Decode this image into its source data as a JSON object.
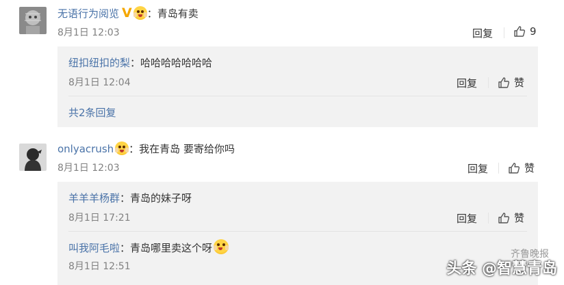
{
  "comments": [
    {
      "user": "无语行为阅览",
      "text": "：青岛有卖",
      "date": "8月1日 12:03",
      "reply_label": "回复",
      "like_count": "9",
      "replies": [
        {
          "user": "纽扣纽扣的梨",
          "text": "：哈哈哈哈哈哈哈",
          "date": "8月1日 12:04",
          "reply_label": "回复",
          "like_label": "赞"
        }
      ],
      "more_replies": "共2条回复"
    },
    {
      "user": "onlyacrush",
      "text": "：我在青岛 要寄给你吗",
      "date": "8月1日 12:03",
      "reply_label": "回复",
      "like_label": "赞",
      "replies": [
        {
          "user": "羊羊羊杨群",
          "text": "：青岛的妹子呀",
          "date": "8月1日 17:21",
          "reply_label": "回复",
          "like_label": "赞"
        },
        {
          "user": "叫我阿毛啦",
          "text": "：青岛哪里卖这个呀",
          "date": "8月1日 12:51"
        }
      ]
    }
  ],
  "watermark": {
    "small": "齐鲁晚报",
    "main": "头条 @智慧青岛"
  },
  "colors": {
    "username": "#4a73a8",
    "reply_bg": "#f2f2f2",
    "badge": "#f5a700"
  },
  "icons": {
    "verified": "v-badge-icon",
    "emoji": "surprised-emoji-icon",
    "like": "thumbs-up-icon"
  }
}
